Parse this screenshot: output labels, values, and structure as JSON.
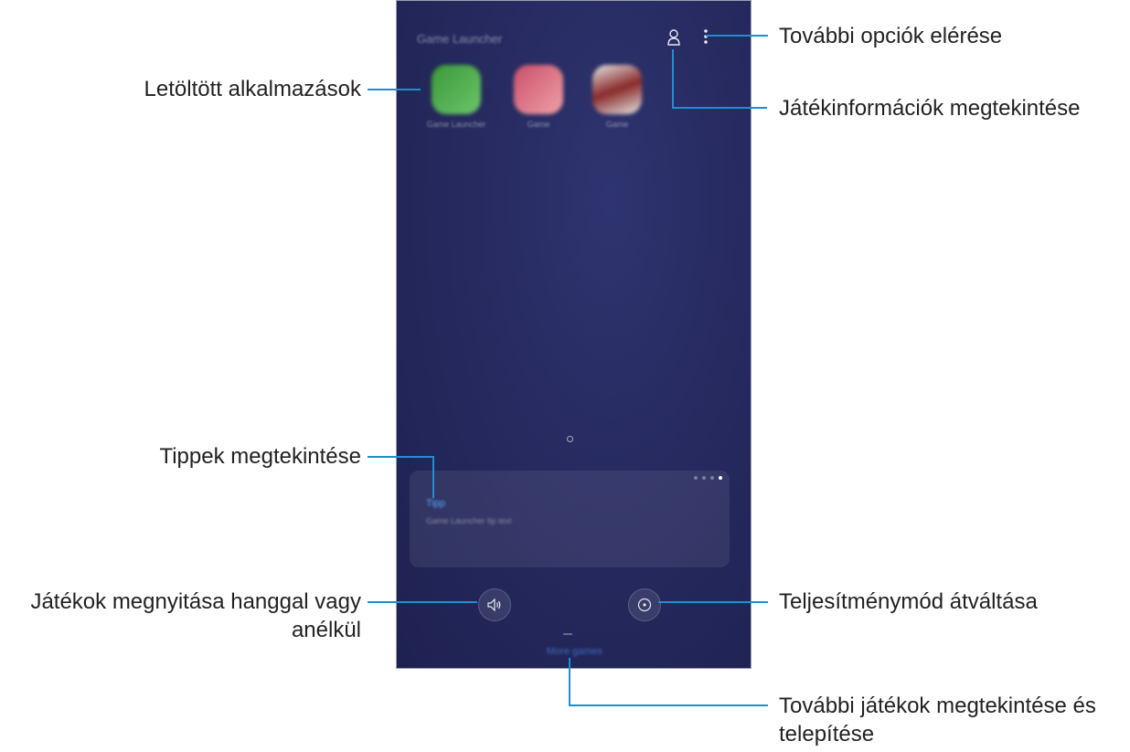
{
  "phone": {
    "app_title": "Game Launcher",
    "apps": [
      {
        "label": "Game Launcher",
        "colors": [
          "#3a9a3a",
          "#6cc46a"
        ]
      },
      {
        "label": "Game",
        "colors": [
          "#c9506a",
          "#f0a0a8"
        ]
      },
      {
        "label": "Game",
        "colors": [
          "#8a2a2a",
          "#e6e6e6"
        ]
      }
    ],
    "tip": {
      "title": "Tipp",
      "text": "Game Launcher tip text"
    },
    "bottom_link": "More games"
  },
  "callouts": {
    "more_options": "További opciók elérése",
    "game_info": "Játékinformációk megtekintése",
    "downloaded_apps": "Letöltött alkalmazások",
    "tips": "Tippek megtekintése",
    "sound_line1": "Játékok megnyitása hanggal vagy",
    "sound_line2": "anélkül",
    "performance": "Teljesítménymód átváltása",
    "more_games_line1": "További játékok megtekintése és",
    "more_games_line2": "telepítése"
  },
  "colors": {
    "accent_line": "#1f8fd1",
    "phone_bg": "#262a5f"
  }
}
